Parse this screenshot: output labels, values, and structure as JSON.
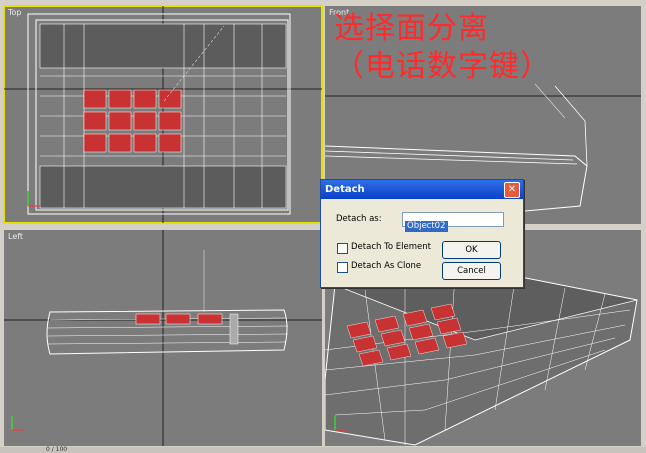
{
  "viewports": {
    "top": {
      "label": "Top"
    },
    "front": {
      "label": "Front"
    },
    "left": {
      "label": "Left"
    },
    "perspective": {
      "label": ""
    }
  },
  "annotation": {
    "line1": "选择面分离",
    "line2": "（电话数字键）"
  },
  "dialog": {
    "title": "Detach",
    "close_icon": "close-icon",
    "detach_as_label": "Detach as:",
    "detach_as_value": "Object02",
    "detach_to_element_label": "Detach To Element",
    "detach_as_clone_label": "Detach As Clone",
    "detach_to_element_checked": false,
    "detach_as_clone_checked": false,
    "ok_label": "OK",
    "cancel_label": "Cancel"
  },
  "status": {
    "text": "0 / 100"
  },
  "colors": {
    "viewport_bg": "#7c7c7c",
    "active_border": "#e8e000",
    "wire": "#ffffff",
    "selected_face": "#c83232",
    "annotation": "#ff2b2b",
    "titlebar": "#0a3fc8"
  }
}
